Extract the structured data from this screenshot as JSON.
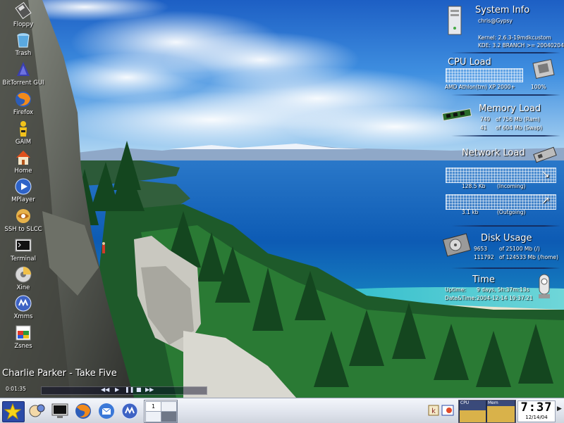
{
  "desktop_icons": [
    {
      "label": "Floppy",
      "icon": "floppy-icon"
    },
    {
      "label": "Trash",
      "icon": "trash-icon"
    },
    {
      "label": "BitTorrent GUI",
      "icon": "bittorrent-icon"
    },
    {
      "label": "Firefox",
      "icon": "firefox-icon"
    },
    {
      "label": "GAIM",
      "icon": "gaim-icon"
    },
    {
      "label": "Home",
      "icon": "home-icon"
    },
    {
      "label": "MPlayer",
      "icon": "mplayer-icon"
    },
    {
      "label": "SSH to SLCC",
      "icon": "ssh-icon"
    },
    {
      "label": "Terminal",
      "icon": "terminal-icon"
    },
    {
      "label": "Xine",
      "icon": "xine-icon"
    },
    {
      "label": "Xmms",
      "icon": "xmms-icon"
    },
    {
      "label": "Zsnes",
      "icon": "zsnes-icon"
    }
  ],
  "system_info": {
    "title": "System Info",
    "user_host": "chris@Gypsy",
    "kernel": "Kernel: 2.6.3-19mdkcustom",
    "kde": "KDE: 3.2 BRANCH >= 20040204"
  },
  "cpu_load": {
    "title": "CPU Load",
    "cpu_name": "AMD Athlon(tm) XP 2000+",
    "percent": "100%",
    "load_fraction": 1.0
  },
  "memory_load": {
    "title": "Memory Load",
    "ram_used": "749",
    "ram_total": "of 756 Mb (Ram)",
    "swap_used": "41",
    "swap_total": "of 604 Mb (Swap)"
  },
  "network_load": {
    "title": "Network Load",
    "incoming_value": "128.5 Kb",
    "incoming_label": "(Incoming)",
    "outgoing_value": "3.1 kb",
    "outgoing_label": "(Outgoing)"
  },
  "disk_usage": {
    "title": "Disk Usage",
    "root_used": "9653",
    "root_total": "of 25100 Mb (/)",
    "home_used": "111792",
    "home_total": "of 124533 Mb (/home)"
  },
  "time_panel": {
    "title": "Time",
    "uptime_label": "Uptime:",
    "uptime_value": "9 days, 5h:37m:13s",
    "datetime_label": "Date&Time:",
    "datetime_value": "2004-12-14  19:37:21"
  },
  "player": {
    "track": "Charlie Parker - Take Five",
    "elapsed": "0:01:35"
  },
  "taskbar": {
    "pager_desktops": [
      "1",
      "",
      "",
      ""
    ],
    "sysmon_labels": [
      "CPU",
      "Mem"
    ],
    "clock_time": "7:37",
    "clock_date": "12/14/04"
  },
  "colors": {
    "panel_separator": "#14285a",
    "taskbar_top": "#f4f6fb",
    "taskbar_bottom": "#cfd4de",
    "sysmon_fill": "#d9b24a"
  }
}
